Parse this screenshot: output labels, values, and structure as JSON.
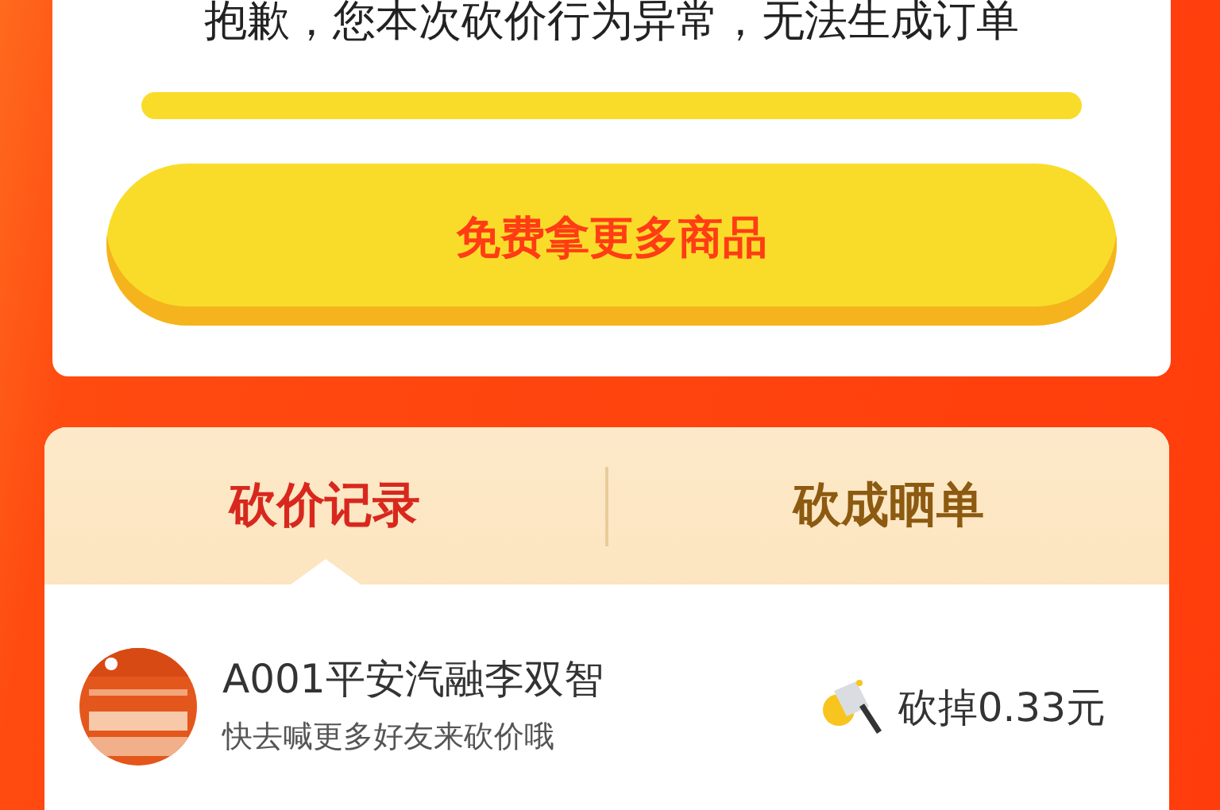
{
  "notice": {
    "message": "抱歉，您本次砍价行为异常，无法生成订单",
    "button": "免费拿更多商品"
  },
  "tabs": [
    {
      "label": "砍价记录",
      "selected": true
    },
    {
      "label": "砍成晒单",
      "selected": false
    }
  ],
  "records": [
    {
      "name": "A001平安汽融李双智",
      "message": "快去喊更多好友来砍价哦",
      "amount": "砍掉0.33元"
    }
  ]
}
